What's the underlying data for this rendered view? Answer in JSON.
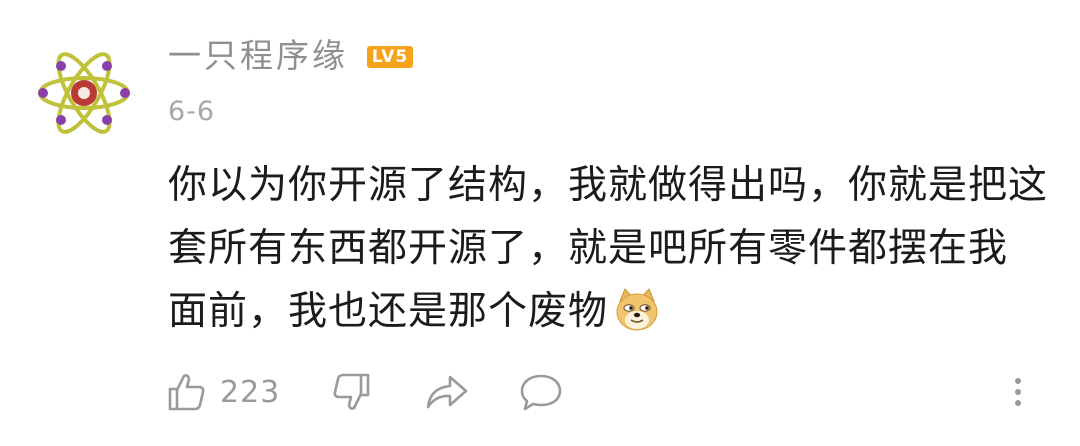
{
  "comment": {
    "author": {
      "name": "一只程序缘",
      "level_badge": "LV5",
      "avatar_icon": "atom-icon"
    },
    "timestamp": "6-6",
    "body_lines": [
      "你以为你开源了结构，我就做得出吗，你就是把这",
      "套所有东西都开源了，就是吧所有零件都摆在我",
      "面前，我也还是那个废物"
    ],
    "trailing_emoji": "doge-emoji"
  },
  "actions": {
    "like_count": "223",
    "like_icon": "thumbs-up-icon",
    "dislike_icon": "thumbs-down-icon",
    "share_icon": "share-arrow-icon",
    "reply_icon": "speech-bubble-icon",
    "more_icon": "more-vertical-icon"
  },
  "colors": {
    "username": "#8f8f8f",
    "timestamp": "#a8a8a8",
    "body_text": "#1b1b1b",
    "icon_gray": "#9a9a9a",
    "level_badge": "#f5a31a"
  }
}
